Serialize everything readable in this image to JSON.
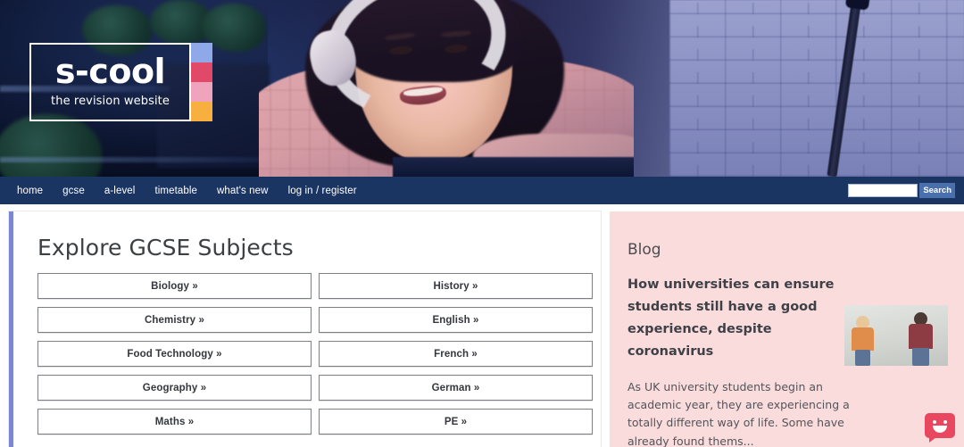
{
  "site": {
    "logo_main": "s-cool",
    "logo_sub": "the revision website",
    "logo_swatches": [
      "#8fa8e8",
      "#e04a68",
      "#f0a3bd",
      "#f7b040"
    ]
  },
  "nav": {
    "items": [
      {
        "label": "home"
      },
      {
        "label": "gcse"
      },
      {
        "label": "a-level"
      },
      {
        "label": "timetable"
      },
      {
        "label": "what's new"
      },
      {
        "label": "log in / register"
      }
    ],
    "search": {
      "value": "",
      "placeholder": "",
      "button_label": "Search"
    },
    "background_color": "#1b3563"
  },
  "main": {
    "title": "Explore GCSE Subjects",
    "accent_color": "#7b87d4",
    "subjects": [
      {
        "label": "Biology »"
      },
      {
        "label": "History »"
      },
      {
        "label": "Chemistry »"
      },
      {
        "label": "English »"
      },
      {
        "label": "Food Technology »"
      },
      {
        "label": "French »"
      },
      {
        "label": "Geography »"
      },
      {
        "label": "German »"
      },
      {
        "label": "Maths »"
      },
      {
        "label": "PE »"
      }
    ]
  },
  "blog": {
    "label": "Blog",
    "headline": "How universities can ensure students still have a good experience, despite coronavirus",
    "excerpt": "As UK university students begin an academic year, they are experiencing a totally different way of life. Some have already found thems...",
    "background_color": "#fbdcdc",
    "thumbnail_alt": "two students standing apart against a wall"
  },
  "feedback": {
    "icon": "smiley-chat-bubble-icon",
    "color": "#e8475f"
  },
  "hero": {
    "alt": "young woman wearing headphones smiling at a laptop, brick wall background"
  }
}
